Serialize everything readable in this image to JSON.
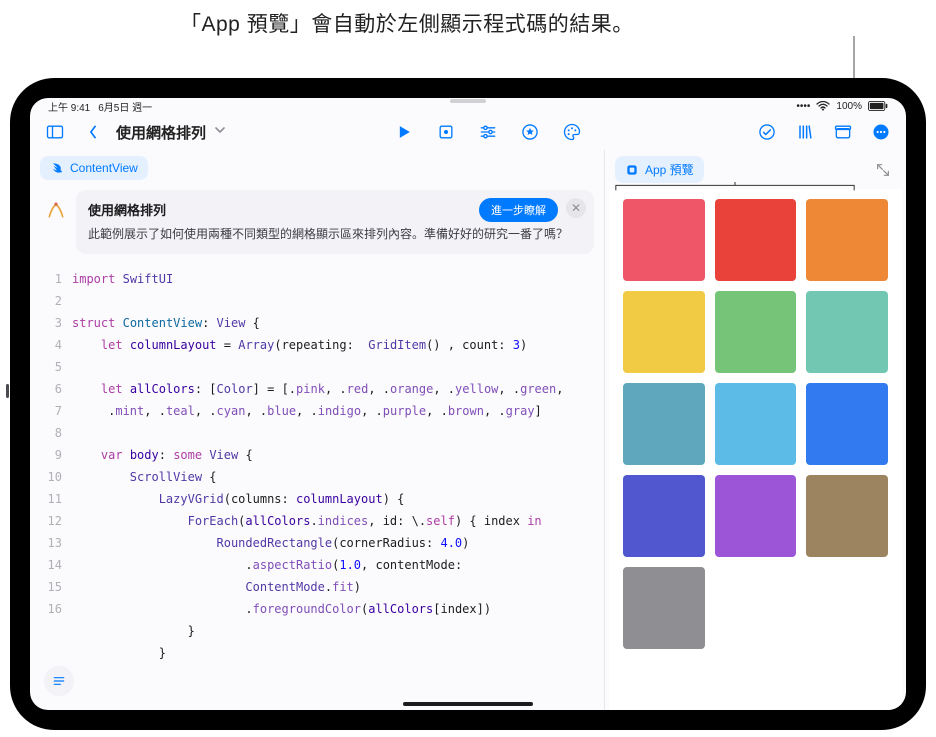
{
  "annotation": "「App 預覽」會自動於左側顯示程式碼的結果。",
  "status": {
    "time": "上午 9:41",
    "date": "6月5日 週一",
    "battery": "100%"
  },
  "toolbar": {
    "project_title": "使用網格排列"
  },
  "chips": {
    "file_tab": "ContentView",
    "preview_tab": "App 預覽"
  },
  "info_card": {
    "title": "使用網格排列",
    "learn_more": "進一步瞭解",
    "body": "此範例展示了如何使用兩種不同類型的網格顯示區來排列內容。準備好好的研究一番了嗎？"
  },
  "code": {
    "lines": [
      {
        "n": "1",
        "html": "<span class='kw'>import</span> <span class='type'>SwiftUI</span>"
      },
      {
        "n": "2",
        "html": ""
      },
      {
        "n": "3",
        "html": "<span class='kw'>struct</span> <span class='id'>ContentView</span>: <span class='type'>View</span> {"
      },
      {
        "n": "4",
        "html": "    <span class='kw'>let</span> <span class='idd'>columnLayout</span> = <span class='type'>Array</span>(repeating:  <span class='type'>GridItem</span>() , count: <span class='num'>3</span>)"
      },
      {
        "n": "5",
        "html": ""
      },
      {
        "n": "6",
        "html": "    <span class='kw'>let</span> <span class='idd'>allColors</span>: [<span class='type'>Color</span>] = [.<span class='method'>pink</span>, .<span class='method'>red</span>, .<span class='method'>orange</span>, .<span class='method'>yellow</span>, .<span class='method'>green</span>,"
      },
      {
        "n": "",
        "html": "     .<span class='method'>mint</span>, .<span class='method'>teal</span>, .<span class='method'>cyan</span>, .<span class='method'>blue</span>, .<span class='method'>indigo</span>, .<span class='method'>purple</span>, .<span class='method'>brown</span>, .<span class='method'>gray</span>]"
      },
      {
        "n": "7",
        "html": ""
      },
      {
        "n": "8",
        "html": "    <span class='kw'>var</span> <span class='idd'>body</span>: <span class='kw'>some</span> <span class='type'>View</span> {"
      },
      {
        "n": "9",
        "html": "        <span class='type'>ScrollView</span> {"
      },
      {
        "n": "10",
        "html": "            <span class='type'>LazyVGrid</span>(columns: <span class='idd'>columnLayout</span>) {"
      },
      {
        "n": "11",
        "html": "                <span class='type'>ForEach</span>(<span class='idd'>allColors</span>.<span class='method'>indices</span>, id: \\.<span class='kw'>self</span>) { index <span class='kw'>in</span>"
      },
      {
        "n": "12",
        "html": "                    <span class='type'>RoundedRectangle</span>(cornerRadius: <span class='num'>4.0</span>)"
      },
      {
        "n": "13",
        "html": "                        .<span class='method'>aspectRatio</span>(<span class='num'>1.0</span>, contentMode:"
      },
      {
        "n": "",
        "html": "                        <span class='type'>ContentMode</span>.<span class='method'>fit</span>)"
      },
      {
        "n": "14",
        "html": "                        .<span class='method'>foregroundColor</span>(<span class='idd'>allColors</span>[index])"
      },
      {
        "n": "15",
        "html": "                }"
      },
      {
        "n": "16",
        "html": "            }"
      }
    ]
  },
  "preview_colors": [
    "#ef5667",
    "#e8423a",
    "#ee8836",
    "#f2cb44",
    "#75c478",
    "#71c7b1",
    "#5fa7bc",
    "#5dbbe7",
    "#317af0",
    "#5157ce",
    "#9d55d8",
    "#9d8460",
    "#8e8e93"
  ]
}
